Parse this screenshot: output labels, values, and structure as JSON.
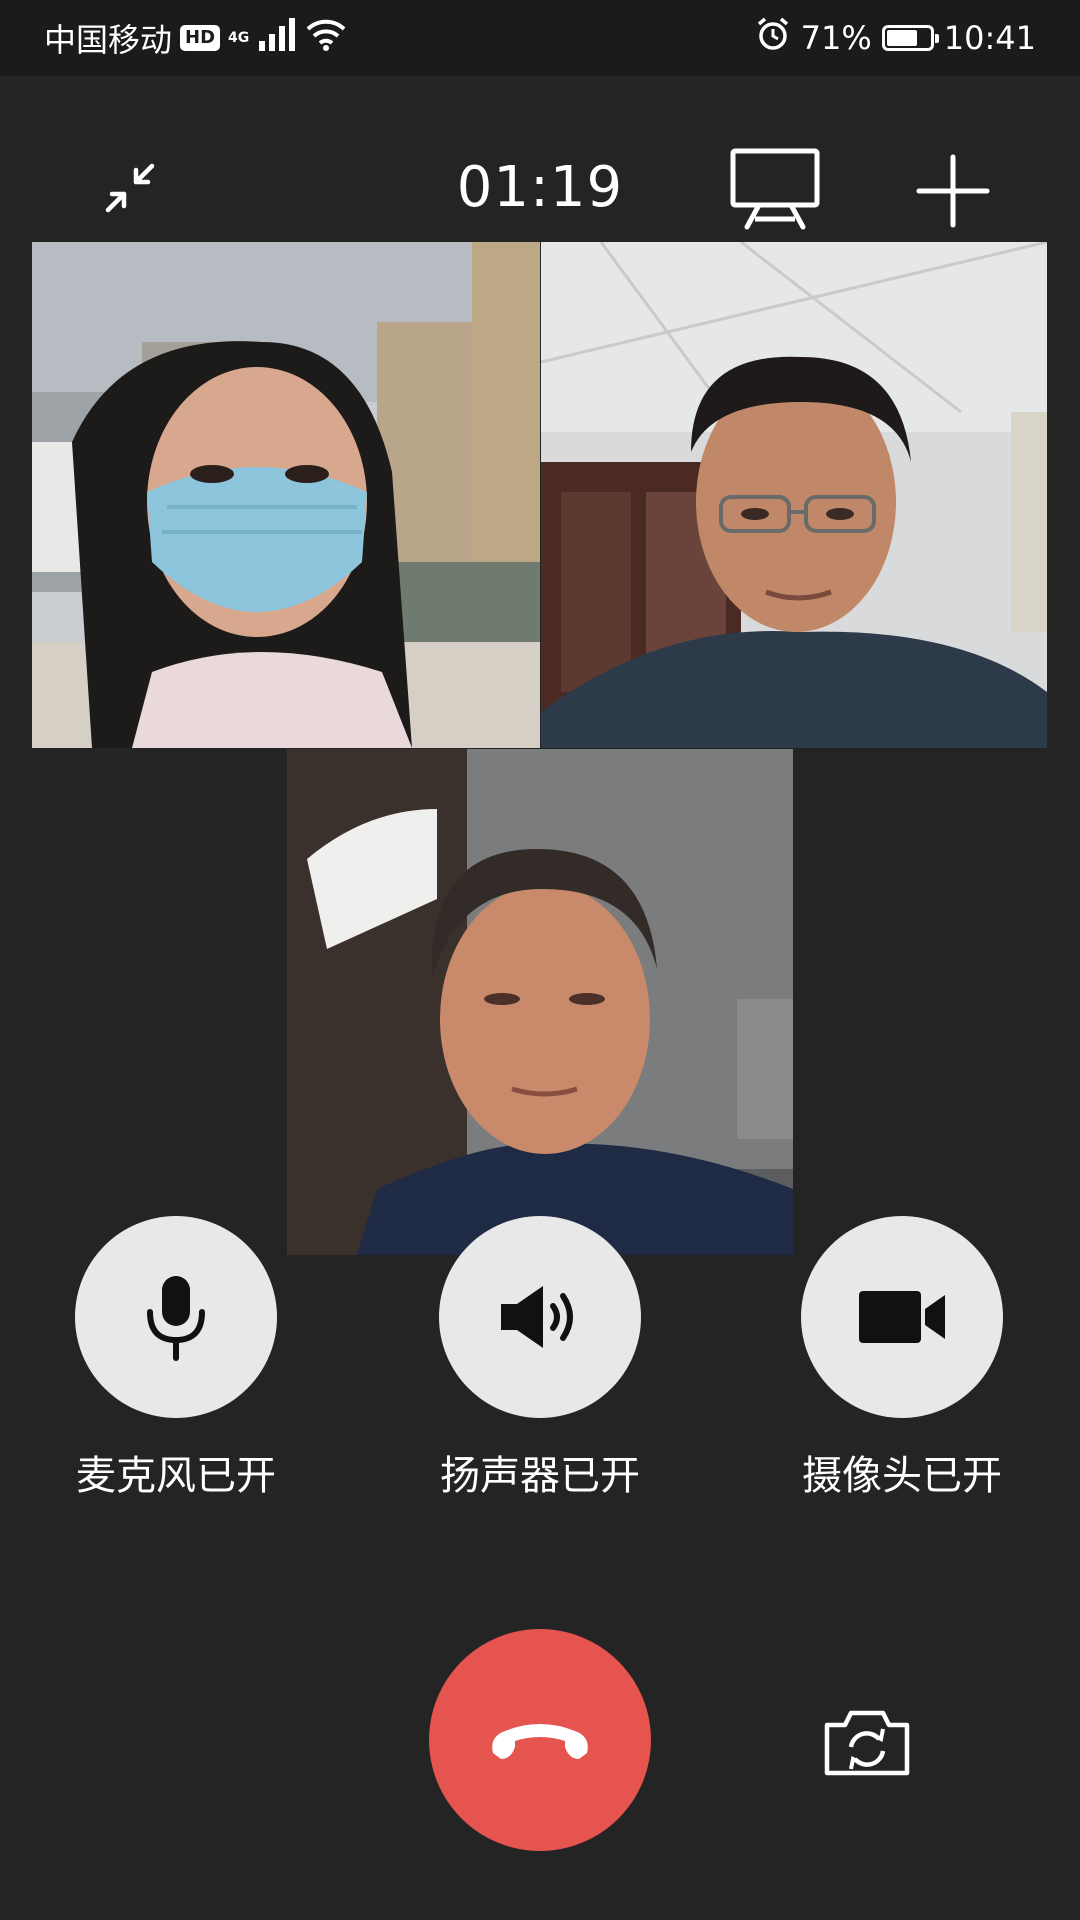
{
  "status_bar": {
    "carrier": "中国移动",
    "hd_badge": "HD",
    "network": "4G",
    "battery_percent": "71%",
    "battery_level": 0.71,
    "time": "10:41",
    "icons": [
      "signal-icon",
      "wifi-icon",
      "alarm-icon",
      "battery-icon"
    ]
  },
  "call": {
    "duration": "01:19",
    "icons": [
      "minimize-icon",
      "screencast-icon",
      "add-icon"
    ]
  },
  "participants": [
    {
      "name": "participant-1",
      "tile": "video-tile-1"
    },
    {
      "name": "participant-2",
      "tile": "video-tile-2"
    },
    {
      "name": "participant-3",
      "tile": "video-tile-3"
    }
  ],
  "controls": {
    "microphone_label": "麦克风已开",
    "speaker_label": "扬声器已开",
    "camera_label": "摄像头已开"
  },
  "actions": {
    "hangup_icon": "hangup-icon",
    "switch_camera_icon": "switch-camera-icon"
  },
  "colors": {
    "background": "#242424",
    "control_button": "#e8e8e8",
    "hangup": "#e5544f"
  }
}
